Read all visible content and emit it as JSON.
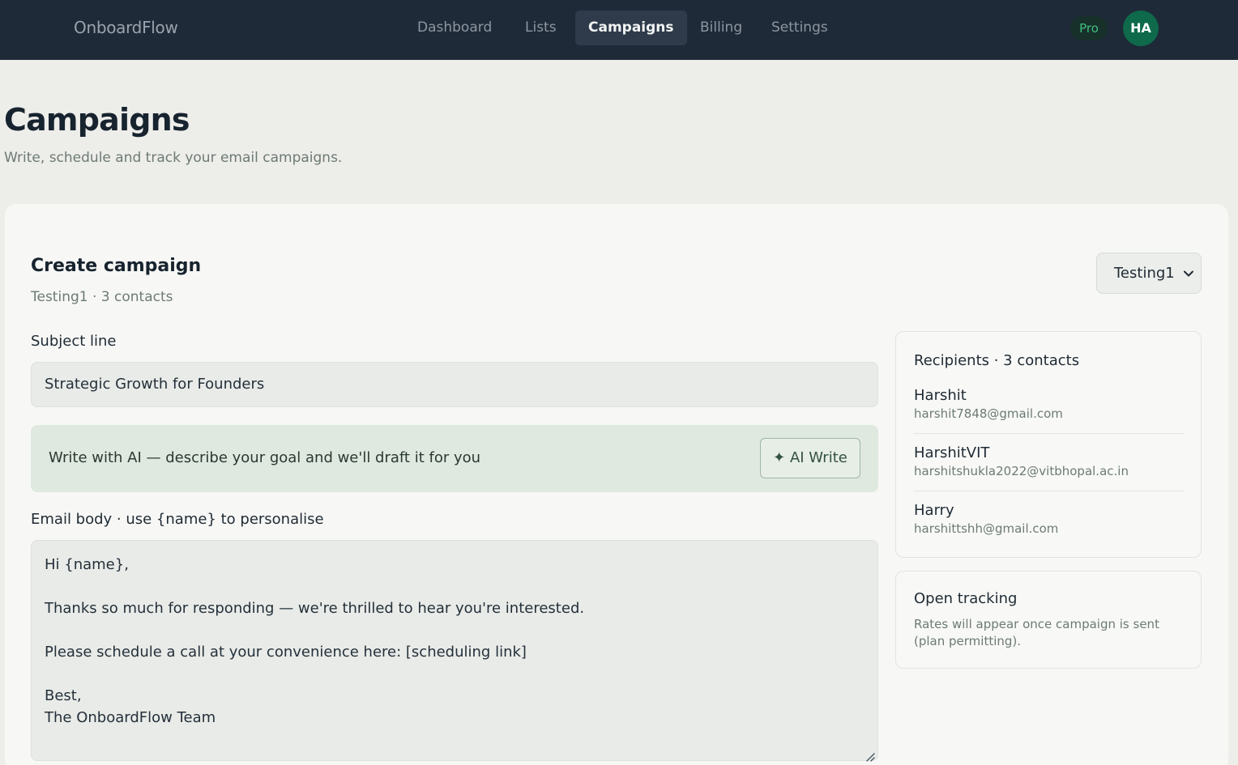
{
  "app": {
    "brand": "OnboardFlow"
  },
  "nav": {
    "items": [
      {
        "label": "Dashboard"
      },
      {
        "label": "Lists"
      },
      {
        "label": "Campaigns",
        "active": true
      },
      {
        "label": "Billing"
      },
      {
        "label": "Settings"
      }
    ]
  },
  "user": {
    "plan_badge": "Pro",
    "initials": "HA"
  },
  "page": {
    "title": "Campaigns",
    "subtitle": "Write, schedule and track your email campaigns."
  },
  "create": {
    "title": "Create campaign",
    "summary": "Testing1 · 3 contacts",
    "list_select": "Testing1",
    "subject_label": "Subject line",
    "subject_value": "Strategic Growth for Founders",
    "ai_prompt": "Write with AI — describe your goal and we'll draft it for you",
    "ai_button": "✦ AI Write",
    "body_label": "Email body · use {name} to personalise",
    "body_value": "Hi {name},\n\nThanks so much for responding — we're thrilled to hear you're interested.\n\nPlease schedule a call at your convenience here: [scheduling link]\n\nBest,\nThe OnboardFlow Team"
  },
  "recipients": {
    "title": "Recipients · 3 contacts",
    "items": [
      {
        "name": "Harshit",
        "email": "harshit7848@gmail.com"
      },
      {
        "name": "HarshitVIT",
        "email": "harshitshukla2022@vitbhopal.ac.in"
      },
      {
        "name": "Harry",
        "email": "harshittshh@gmail.com"
      }
    ]
  },
  "tracking": {
    "title": "Open tracking",
    "text": "Rates will appear once campaign is sent (plan permitting)."
  },
  "colors": {
    "topbar": "#1e2a38",
    "accent_green": "#0e6a4a",
    "ai_bar": "#dfe9df"
  },
  "icons": {
    "select_caret": "chevron-down-icon",
    "resize_handle": "resize-grip-icon"
  }
}
